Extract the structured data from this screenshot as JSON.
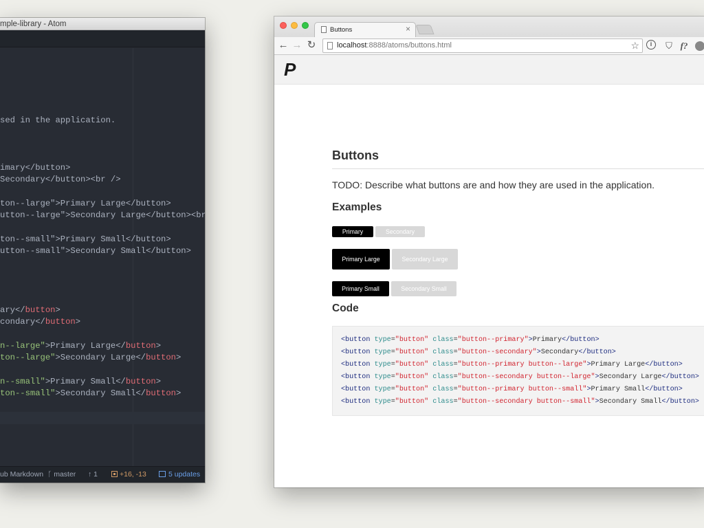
{
  "atom": {
    "title": "mple-library - Atom",
    "lines": [
      {
        "parts": [
          {
            "t": "sed in the application."
          }
        ]
      },
      {
        "parts": [
          {
            "t": "imary</button>"
          }
        ]
      },
      {
        "parts": [
          {
            "t": "Secondary</button><br />"
          }
        ]
      },
      {
        "parts": [
          {
            "t": "ton--large\">Primary Large</button>"
          }
        ]
      },
      {
        "parts": [
          {
            "t": "utton--large\">Secondary Large</button><br />"
          }
        ]
      },
      {
        "parts": [
          {
            "t": "ton--small\">Primary Small</button>"
          }
        ]
      },
      {
        "parts": [
          {
            "t": "utton--small\">Secondary Small</button>"
          }
        ]
      },
      {
        "parts": [
          {
            "t": "ary</"
          },
          {
            "t": "button",
            "c": "tag"
          },
          {
            "t": ">"
          }
        ]
      },
      {
        "parts": [
          {
            "t": "condary</"
          },
          {
            "t": "button",
            "c": "tag"
          },
          {
            "t": ">"
          }
        ]
      },
      {
        "parts": [
          {
            "t": "n--large\"",
            "c": "str"
          },
          {
            "t": ">Primary Large</"
          },
          {
            "t": "button",
            "c": "tag"
          },
          {
            "t": ">"
          }
        ]
      },
      {
        "parts": [
          {
            "t": "ton--large\"",
            "c": "str"
          },
          {
            "t": ">Secondary Large</"
          },
          {
            "t": "button",
            "c": "tag"
          },
          {
            "t": ">"
          }
        ]
      },
      {
        "parts": [
          {
            "t": "n--small\"",
            "c": "str"
          },
          {
            "t": ">Primary Small</"
          },
          {
            "t": "button",
            "c": "tag"
          },
          {
            "t": ">"
          }
        ]
      },
      {
        "parts": [
          {
            "t": "ton--small\"",
            "c": "str"
          },
          {
            "t": ">Secondary Small</"
          },
          {
            "t": "button",
            "c": "tag"
          },
          {
            "t": ">"
          }
        ]
      }
    ],
    "status": {
      "grammar": "ub Markdown",
      "branch": "master",
      "ahead": "1",
      "diff": "+16, -13",
      "updates": "5 updates"
    }
  },
  "browser": {
    "tab_title": "Buttons",
    "tab_close": "×",
    "url_host": "localhost",
    "url_path": ":8888/atoms/buttons.html",
    "back": "←",
    "forward": "→",
    "reload": "↻",
    "star": "☆",
    "ext_info": "i",
    "ext_shield": "⛉",
    "ext_f": "f?"
  },
  "page": {
    "logo": "P",
    "heading": "Buttons",
    "description": "TODO: Describe what buttons are and how they are used in the application.",
    "examples_heading": "Examples",
    "code_heading": "Code",
    "buttons": {
      "primary": "Primary",
      "secondary": "Secondary",
      "primary_large": "Primary Large",
      "secondary_large": "Secondary Large",
      "primary_small": "Primary Small",
      "secondary_small": "Secondary Small"
    },
    "code_lines": [
      {
        "cls": "button--primary",
        "text": "Primary"
      },
      {
        "cls": "button--secondary",
        "text": "Secondary"
      },
      {
        "cls": "button--primary button--large",
        "text": "Primary Large"
      },
      {
        "cls": "button--secondary button--large",
        "text": "Secondary Large"
      },
      {
        "cls": "button--primary button--small",
        "text": "Primary Small"
      },
      {
        "cls": "button--secondary button--small",
        "text": "Secondary Small"
      }
    ]
  },
  "colors": {
    "editor_bg": "#282c34",
    "string": "#98c379",
    "tag": "#e06c75",
    "primary_button": "#000000",
    "secondary_button": "#d8d8d8"
  }
}
